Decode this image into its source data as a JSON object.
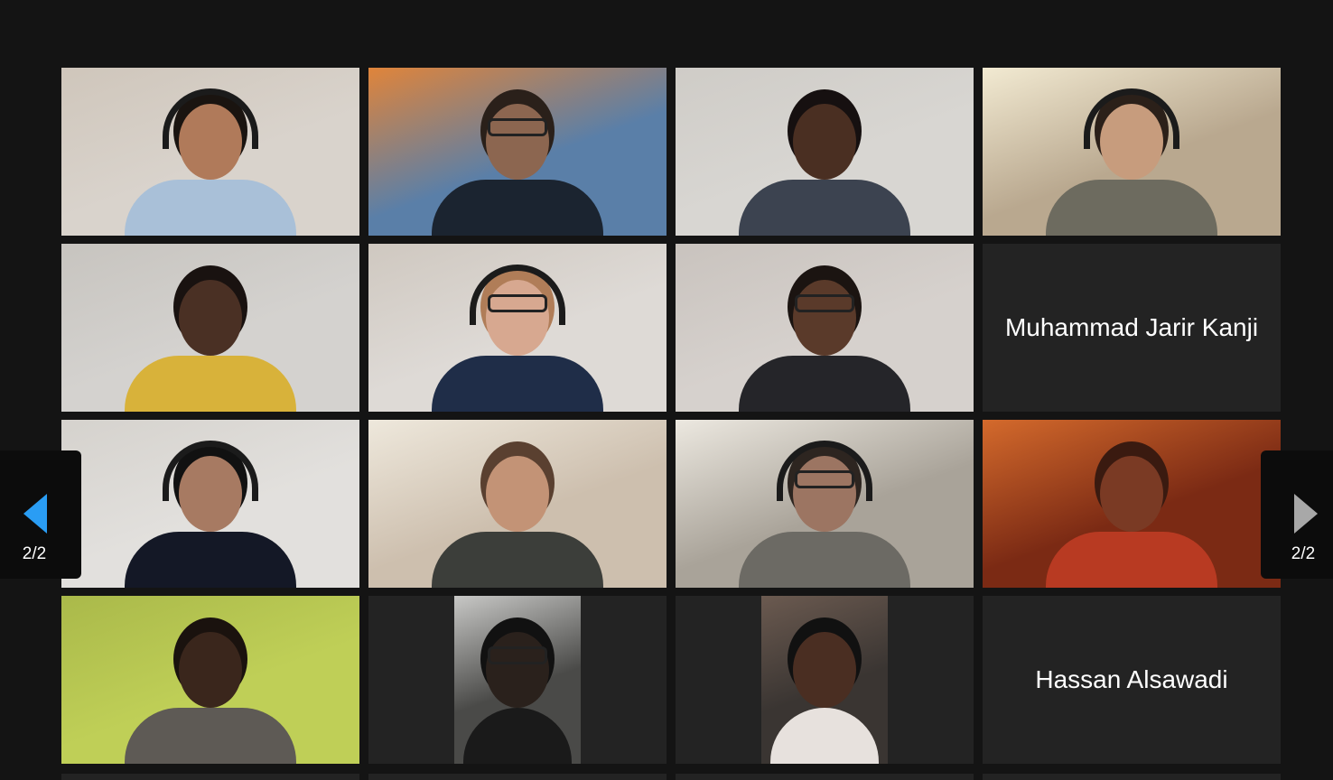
{
  "page_indicator_left": "2/2",
  "page_indicator_right": "2/2",
  "participants": [
    {
      "name": "",
      "video": true,
      "bg": "#d9d3cc",
      "accent": "#cfc6bb",
      "skin": "#b07a5a",
      "shirt": "#a9c0d8",
      "hair": "#1a1410",
      "headset": true,
      "glasses": false
    },
    {
      "name": "",
      "video": true,
      "bg": "#5a7fa8",
      "accent": "#e0843a",
      "skin": "#8c6650",
      "shirt": "#1b2430",
      "hair": "#2a201a",
      "headset": false,
      "glasses": true
    },
    {
      "name": "",
      "video": true,
      "bg": "#d8d6d2",
      "accent": "#cfccc7",
      "skin": "#4a2f22",
      "shirt": "#3c4350",
      "hair": "#161010",
      "headset": false,
      "glasses": false
    },
    {
      "name": "",
      "video": true,
      "bg": "#b9a88f",
      "accent": "#f2ead2",
      "skin": "#c79c7d",
      "shirt": "#6d6b5f",
      "hair": "#2b2019",
      "headset": true,
      "glasses": false
    },
    {
      "name": "",
      "video": true,
      "bg": "#d4d2cf",
      "accent": "#c7c4bf",
      "skin": "#4a3024",
      "shirt": "#d8b23a",
      "hair": "#191210",
      "headset": false,
      "glasses": false
    },
    {
      "name": "",
      "video": true,
      "bg": "#dedad6",
      "accent": "#cfc8c0",
      "skin": "#d7a890",
      "shirt": "#1f2d48",
      "hair": "#b07d58",
      "headset": true,
      "glasses": true
    },
    {
      "name": "",
      "video": true,
      "bg": "#d6d1cd",
      "accent": "#c9c3be",
      "skin": "#5a3a2a",
      "shirt": "#252529",
      "hair": "#1b1411",
      "headset": false,
      "glasses": true
    },
    {
      "name": "Muhammad Jarir Kanji",
      "video": false
    },
    {
      "name": "",
      "video": true,
      "bg": "#e2e0dd",
      "accent": "#d5d2cd",
      "skin": "#a77a62",
      "shirt": "#141826",
      "hair": "#111111",
      "headset": true,
      "glasses": false
    },
    {
      "name": "",
      "video": true,
      "bg": "#cdbfae",
      "accent": "#eee8dc",
      "skin": "#c39376",
      "shirt": "#3c3e3a",
      "hair": "#5a4030",
      "headset": false,
      "glasses": false
    },
    {
      "name": "",
      "video": true,
      "bg": "#a9a399",
      "accent": "#ece8e0",
      "skin": "#9c7562",
      "shirt": "#6c6a64",
      "hair": "#2d2520",
      "headset": true,
      "glasses": true
    },
    {
      "name": "",
      "video": true,
      "bg": "#7b2a14",
      "accent": "#d46a2c",
      "skin": "#7a3a24",
      "shirt": "#b83a22",
      "hair": "#3a1a10",
      "headset": false,
      "glasses": false
    },
    {
      "name": "",
      "video": true,
      "bg": "#bfcf57",
      "accent": "#aab94a",
      "skin": "#3a261c",
      "shirt": "#5e5a55",
      "hair": "#1a120e",
      "headset": false,
      "glasses": false
    },
    {
      "name": "",
      "video": true,
      "bg": "#4a4a48",
      "accent": "#c8c8c6",
      "skin": "#2a211c",
      "shirt": "#1a1a1a",
      "hair": "#111111",
      "headset": false,
      "glasses": true,
      "narrow": true
    },
    {
      "name": "",
      "video": true,
      "bg": "#3a3532",
      "accent": "#6b5a50",
      "skin": "#4a2e22",
      "shirt": "#e7e1dd",
      "hair": "#111111",
      "headset": false,
      "glasses": false,
      "narrow": true
    },
    {
      "name": "Hassan Alsawadi",
      "video": false
    }
  ]
}
